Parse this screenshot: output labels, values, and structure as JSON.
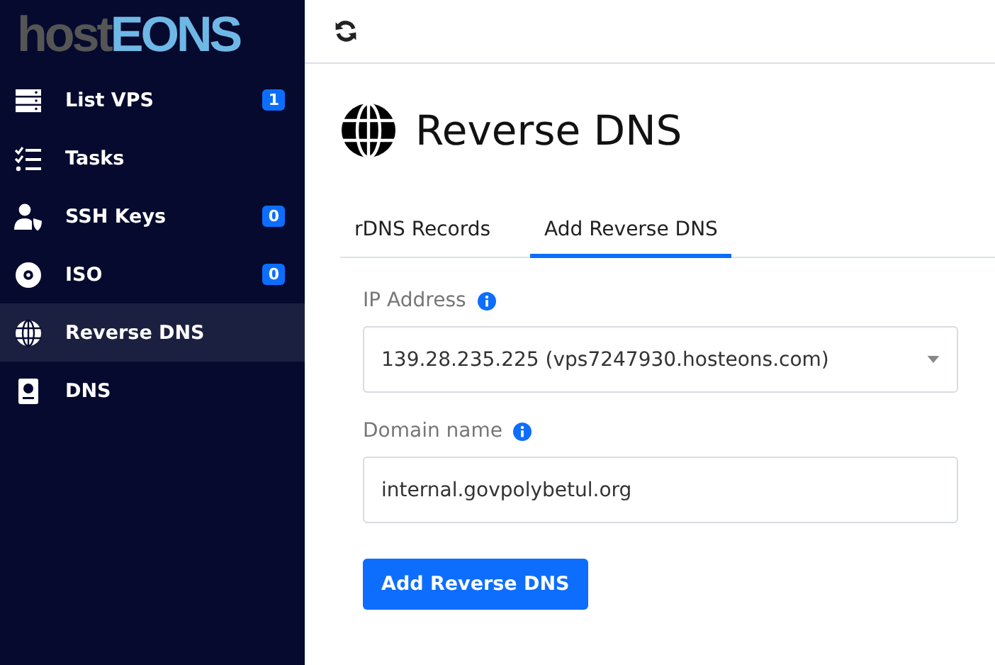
{
  "logo": {
    "part_1": "host",
    "part_2": "EONS"
  },
  "sidebar": {
    "items": [
      {
        "label": "List VPS",
        "badge": "1",
        "selected": false
      },
      {
        "label": "Tasks",
        "selected": false
      },
      {
        "label": "SSH Keys",
        "badge": "0",
        "selected": false
      },
      {
        "label": "ISO",
        "badge": "0",
        "selected": false
      },
      {
        "label": "Reverse DNS",
        "selected": true
      },
      {
        "label": "DNS",
        "selected": false
      }
    ]
  },
  "page": {
    "title": "Reverse DNS"
  },
  "tabs": [
    {
      "label": "rDNS Records",
      "selected": false
    },
    {
      "label": "Add Reverse DNS",
      "selected": true
    }
  ],
  "form": {
    "fields": [
      {
        "kind": "select",
        "label": "IP Address",
        "value": "139.28.235.225 (vps7247930.hosteons.com)"
      },
      {
        "kind": "text",
        "label": "Domain name",
        "value": "internal.govpolybetul.org"
      }
    ],
    "submit": "Add Reverse DNS"
  }
}
